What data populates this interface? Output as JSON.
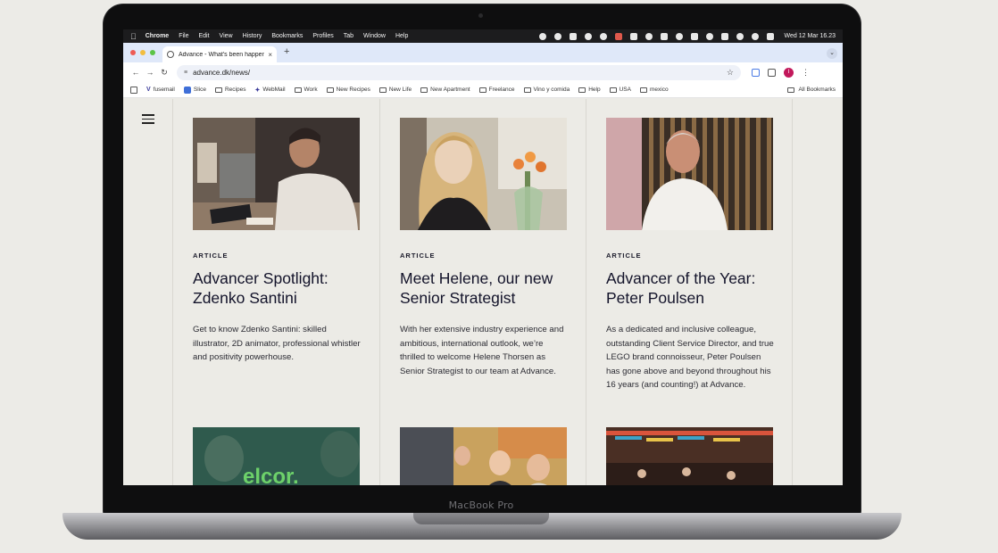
{
  "device": {
    "model_label": "MacBook Pro"
  },
  "menubar": {
    "app": "Chrome",
    "items": [
      "File",
      "Edit",
      "View",
      "History",
      "Bookmarks",
      "Profiles",
      "Tab",
      "Window",
      "Help"
    ],
    "clock": "Wed 12 Mar  16.23"
  },
  "browser": {
    "tab": {
      "title": "Advance - What's been happening",
      "close": "×"
    },
    "new_tab": "+",
    "tab_menu": "⌄",
    "nav": {
      "back": "←",
      "forward": "→",
      "reload": "↻"
    },
    "url": "advance.dk/news/",
    "site_info_icon": "≡",
    "star": "☆",
    "profile_initial": "I",
    "menu": "⋮"
  },
  "bookmarks": [
    {
      "label": "fusemail",
      "icon": "letter-icon",
      "glyph": "V"
    },
    {
      "label": "Slice",
      "icon": "slice-icon"
    },
    {
      "label": "Recipes",
      "icon": "folder-icon"
    },
    {
      "label": "WebMail",
      "icon": "letter-icon",
      "glyph": "✦"
    },
    {
      "label": "Work",
      "icon": "folder-icon"
    },
    {
      "label": "New Recipes",
      "icon": "folder-icon"
    },
    {
      "label": "New Life",
      "icon": "folder-icon"
    },
    {
      "label": "New Apartment",
      "icon": "folder-icon"
    },
    {
      "label": "Freelance",
      "icon": "folder-icon"
    },
    {
      "label": "Vino y comida",
      "icon": "folder-icon"
    },
    {
      "label": "Help",
      "icon": "folder-icon"
    },
    {
      "label": "USA",
      "icon": "folder-icon"
    },
    {
      "label": "mexico",
      "icon": "folder-icon"
    }
  ],
  "all_bookmarks": "All Bookmarks",
  "articles": [
    {
      "tag": "ARTICLE",
      "title": "Advancer Spotlight: Zdenko Santini",
      "excerpt": "Get to know Zdenko Santini: skilled illustrator, 2D animator, professional whistler and positivity powerhouse."
    },
    {
      "tag": "ARTICLE",
      "title": "Meet Helene, our new Senior Strategist",
      "excerpt": "With her extensive industry experience and ambitious, international outlook, we’re thrilled to welcome Helene Thorsen as Senior Strategist to our team at Advance."
    },
    {
      "tag": "ARTICLE",
      "title": "Advancer of the Year: Peter Poulsen",
      "excerpt": "As a dedicated and inclusive colleague, outstanding Client Service Director, and true LEGO brand connoisseur, Peter Poulsen has gone above and beyond throughout his 16 years (and counting!) at Advance."
    }
  ],
  "next_row": {
    "thumb_1_text": "elcor."
  },
  "colors": {
    "page_bg": "#ecebe6",
    "title": "#13132a",
    "thumb_green": "#6dd16a"
  }
}
